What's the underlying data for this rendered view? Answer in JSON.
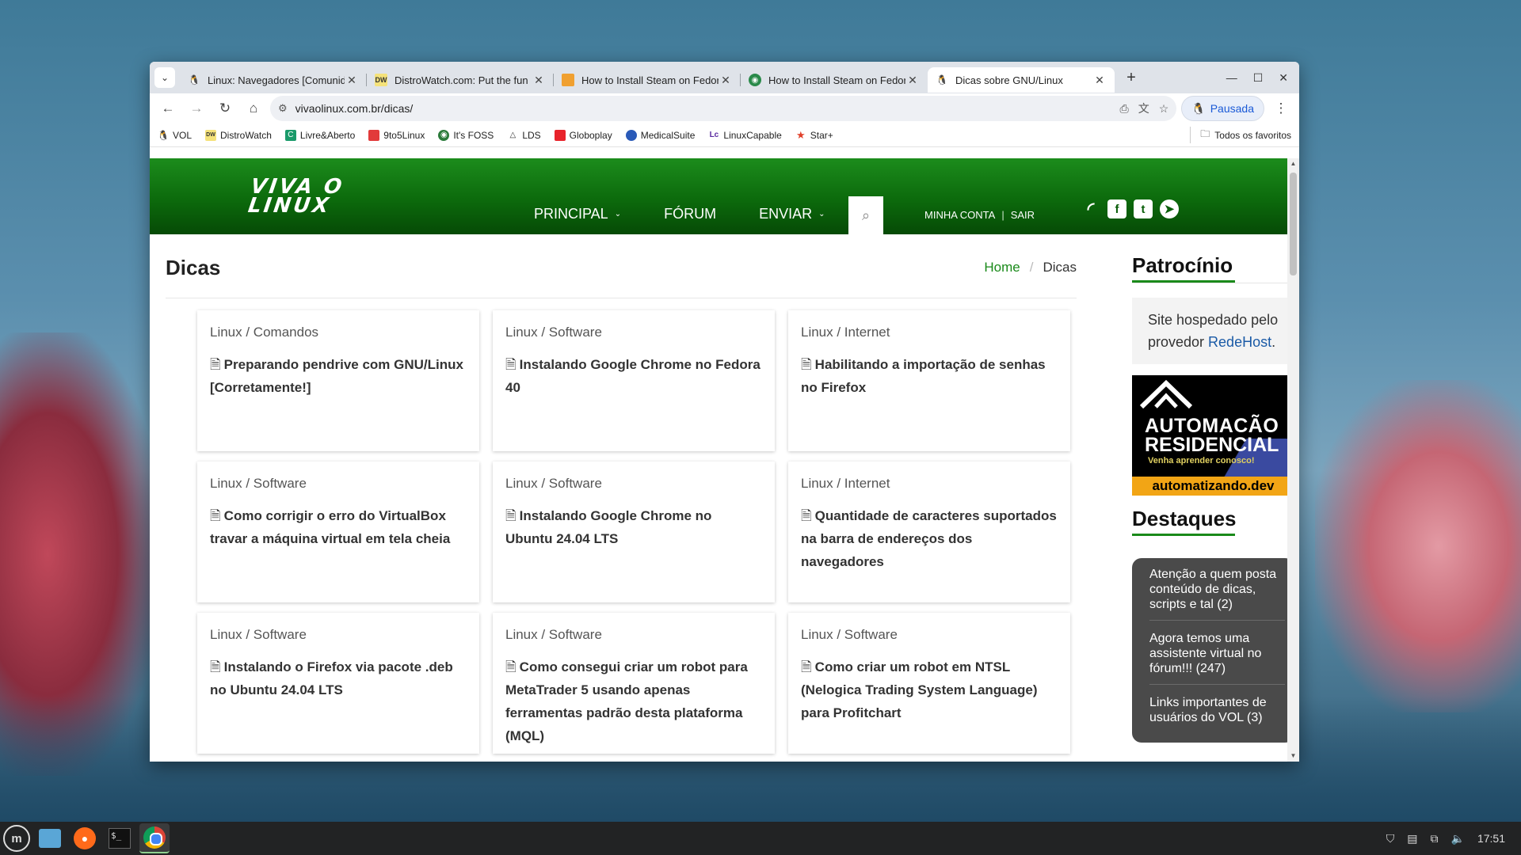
{
  "browser": {
    "tabs": [
      {
        "title": "Linux: Navegadores [Comunidade]",
        "icon": "penguin-icon"
      },
      {
        "title": "DistroWatch.com: Put the fun back",
        "icon": "distrowatch-icon"
      },
      {
        "title": "How to Install Steam on Fedora",
        "icon": "linuxcapable-icon"
      },
      {
        "title": "How to Install Steam on Fedora",
        "icon": "globe-icon"
      },
      {
        "title": "Dicas sobre GNU/Linux",
        "icon": "penguin-icon"
      }
    ],
    "url": "vivaolinux.com.br/dicas/",
    "profile_label": "Pausada",
    "bookmarks": [
      {
        "label": "VOL",
        "color": "#333333"
      },
      {
        "label": "DistroWatch",
        "color": "#d4b100"
      },
      {
        "label": "Livre&Aberto",
        "color": "#1a9a6a"
      },
      {
        "label": "9to5Linux",
        "color": "#e23a3a"
      },
      {
        "label": "It's FOSS",
        "color": "#2a7a3a"
      },
      {
        "label": "LDS",
        "color": "#444444"
      },
      {
        "label": "Globoplay",
        "color": "#e8232b"
      },
      {
        "label": "MedicalSuite",
        "color": "#2a5ab8"
      },
      {
        "label": "LinuxCapable",
        "color": "#5a2aa0"
      },
      {
        "label": "Star+",
        "color": "#e0402a"
      }
    ],
    "all_bookmarks_label": "Todos os favoritos"
  },
  "site": {
    "logo_line1": "VIVA O",
    "logo_line2": "LINUX",
    "nav": {
      "principal": "PRINCIPAL",
      "forum": "FÓRUM",
      "enviar": "ENVIAR"
    },
    "account": "MINHA CONTA",
    "account_sep": "|",
    "logout": "SAIR"
  },
  "main": {
    "title": "Dicas",
    "breadcrumb_home": "Home",
    "breadcrumb_sep": "/",
    "breadcrumb_current": "Dicas",
    "cards": [
      {
        "category": "Linux / Comandos",
        "title": "Preparando pendrive com GNU/Linux [Corretamente!]"
      },
      {
        "category": "Linux / Software",
        "title": "Instalando Google Chrome no Fedora 40"
      },
      {
        "category": "Linux / Internet",
        "title": "Habilitando a importação de senhas no Firefox"
      },
      {
        "category": "Linux / Software",
        "title": "Como corrigir o erro do VirtualBox travar a máquina virtual em tela cheia"
      },
      {
        "category": "Linux / Software",
        "title": "Instalando Google Chrome no Ubuntu 24.04 LTS"
      },
      {
        "category": "Linux / Internet",
        "title": "Quantidade de caracteres suportados na barra de endereços dos navegadores"
      },
      {
        "category": "Linux / Software",
        "title": "Instalando o Firefox via pacote .deb no Ubuntu 24.04 LTS"
      },
      {
        "category": "Linux / Software",
        "title": "Como consegui criar um robot para MetaTrader 5 usando apenas ferramentas padrão desta plataforma (MQL)"
      },
      {
        "category": "Linux / Software",
        "title": "Como criar um robot em NTSL (Nelogica Trading System Language) para Profitchart"
      }
    ]
  },
  "sidebar": {
    "sponsor_heading": "Patrocínio",
    "sponsor_text": "Site hospedado pelo provedor ",
    "sponsor_link": "RedeHost",
    "sponsor_end": ".",
    "ad_line1": "AUTOMACÃO",
    "ad_line2": "RESIDENCIAL",
    "ad_line3": "Venha aprender conosco!",
    "ad_footer": "automatizando.dev",
    "highlights_heading": "Destaques",
    "highlights": [
      "Atenção a quem posta conteúdo de dicas, scripts e tal (2)",
      "Agora temos uma assistente virtual no fórum!!! (247)",
      "Links importantes de usuários do VOL (3)"
    ]
  },
  "taskbar": {
    "clock": "17:51",
    "terminal_glyph": "$_"
  }
}
